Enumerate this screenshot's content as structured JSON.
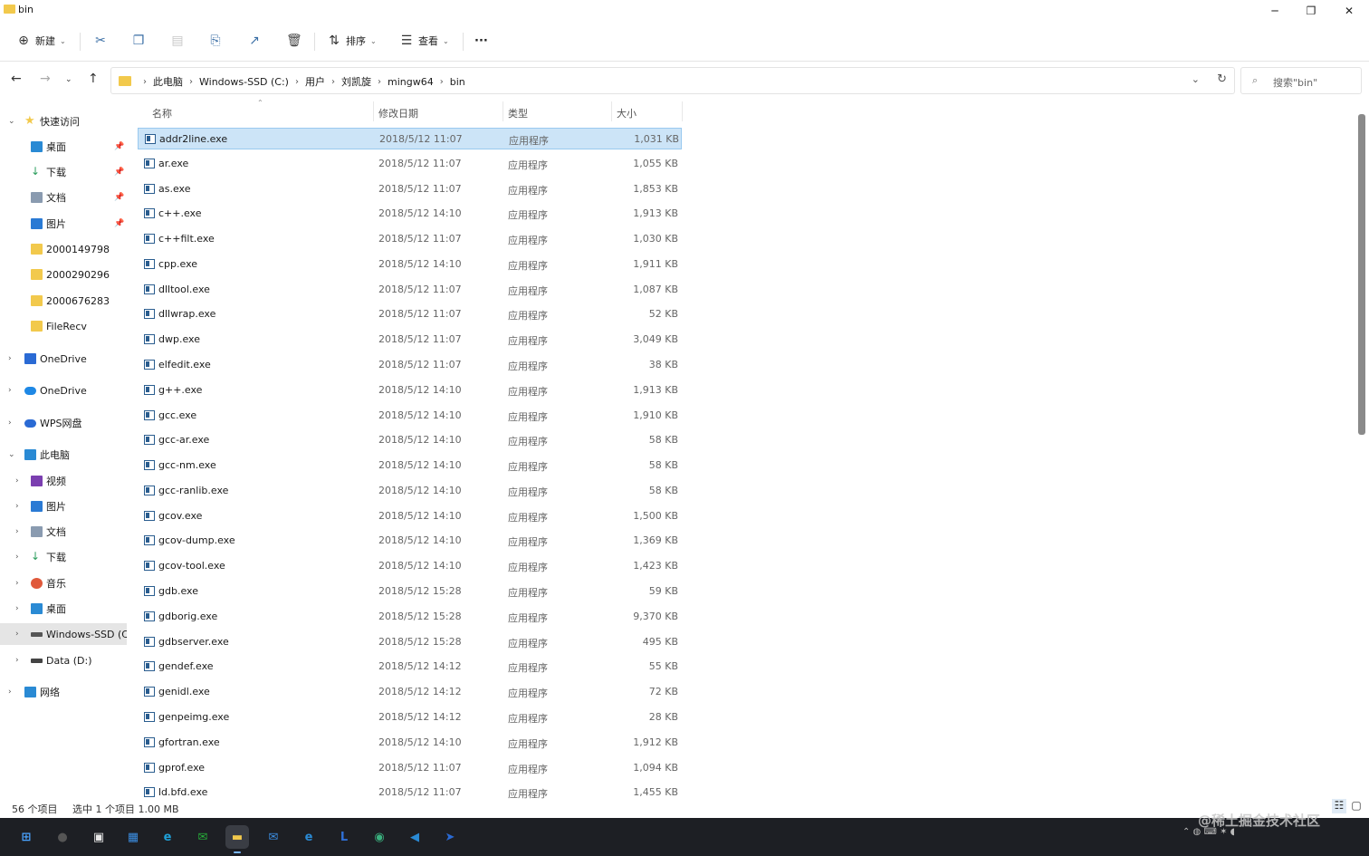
{
  "window": {
    "title": "bin",
    "minimize": "─",
    "maximize": "❐",
    "close": "✕"
  },
  "toolbar": {
    "new_label": "新建",
    "sort_label": "排序",
    "view_label": "查看",
    "more_label": "···"
  },
  "address": {
    "crumbs": [
      "此电脑",
      "Windows-SSD (C:)",
      "用户",
      "刘凯旋",
      "mingw64",
      "bin"
    ],
    "search_placeholder": "搜索\"bin\""
  },
  "nav": {
    "items": [
      {
        "label": "快速访问",
        "icon": "star-icon",
        "color": "#f2c94c"
      },
      {
        "label": "桌面",
        "icon": "desktop-icon",
        "color": "#2a8ad4"
      },
      {
        "label": "下载",
        "icon": "download-icon",
        "color": "#2a9d5c"
      },
      {
        "label": "文档",
        "icon": "document-icon",
        "color": "#8a9bb0"
      },
      {
        "label": "图片",
        "icon": "pictures-icon",
        "color": "#2a7ad4"
      },
      {
        "label": "2000149798",
        "icon": "folder-icon",
        "color": "#f2c94c"
      },
      {
        "label": "2000290296",
        "icon": "folder-icon",
        "color": "#f2c94c"
      },
      {
        "label": "2000676283",
        "icon": "folder-icon",
        "color": "#f2c94c"
      },
      {
        "label": "FileRecv",
        "icon": "folder-icon",
        "color": "#f2c94c"
      },
      {
        "label": "OneDrive",
        "icon": "onedrive-icon",
        "color": "#2a6ad4"
      },
      {
        "label": "OneDrive",
        "icon": "cloud-icon",
        "color": "#1e88e5"
      },
      {
        "label": "WPS网盘",
        "icon": "wps-cloud-icon",
        "color": "#2a6ad4"
      },
      {
        "label": "此电脑",
        "icon": "pc-icon",
        "color": "#2a8ad4"
      },
      {
        "label": "视频",
        "icon": "video-icon",
        "color": "#7b3fb0"
      },
      {
        "label": "图片",
        "icon": "pictures-icon",
        "color": "#2a7ad4"
      },
      {
        "label": "文档",
        "icon": "document-icon",
        "color": "#8a9bb0"
      },
      {
        "label": "下载",
        "icon": "download-icon",
        "color": "#2a9d5c"
      },
      {
        "label": "音乐",
        "icon": "music-icon",
        "color": "#e0593b"
      },
      {
        "label": "桌面",
        "icon": "desktop-icon",
        "color": "#2a8ad4"
      },
      {
        "label": "Windows-SSD (C:)",
        "icon": "drive-icon",
        "color": "#555555"
      },
      {
        "label": "Data (D:)",
        "icon": "drive-icon",
        "color": "#444444"
      },
      {
        "label": "网络",
        "icon": "network-icon",
        "color": "#2a8ad4"
      }
    ]
  },
  "list": {
    "columns": [
      "名称",
      "修改日期",
      "类型",
      "大小"
    ],
    "rows": [
      [
        "addr2line.exe",
        "2018/5/12 11:07",
        "应用程序",
        "1,031 KB"
      ],
      [
        "ar.exe",
        "2018/5/12 11:07",
        "应用程序",
        "1,055 KB"
      ],
      [
        "as.exe",
        "2018/5/12 11:07",
        "应用程序",
        "1,853 KB"
      ],
      [
        "c++.exe",
        "2018/5/12 14:10",
        "应用程序",
        "1,913 KB"
      ],
      [
        "c++filt.exe",
        "2018/5/12 11:07",
        "应用程序",
        "1,030 KB"
      ],
      [
        "cpp.exe",
        "2018/5/12 14:10",
        "应用程序",
        "1,911 KB"
      ],
      [
        "dlltool.exe",
        "2018/5/12 11:07",
        "应用程序",
        "1,087 KB"
      ],
      [
        "dllwrap.exe",
        "2018/5/12 11:07",
        "应用程序",
        "52 KB"
      ],
      [
        "dwp.exe",
        "2018/5/12 11:07",
        "应用程序",
        "3,049 KB"
      ],
      [
        "elfedit.exe",
        "2018/5/12 11:07",
        "应用程序",
        "38 KB"
      ],
      [
        "g++.exe",
        "2018/5/12 14:10",
        "应用程序",
        "1,913 KB"
      ],
      [
        "gcc.exe",
        "2018/5/12 14:10",
        "应用程序",
        "1,910 KB"
      ],
      [
        "gcc-ar.exe",
        "2018/5/12 14:10",
        "应用程序",
        "58 KB"
      ],
      [
        "gcc-nm.exe",
        "2018/5/12 14:10",
        "应用程序",
        "58 KB"
      ],
      [
        "gcc-ranlib.exe",
        "2018/5/12 14:10",
        "应用程序",
        "58 KB"
      ],
      [
        "gcov.exe",
        "2018/5/12 14:10",
        "应用程序",
        "1,500 KB"
      ],
      [
        "gcov-dump.exe",
        "2018/5/12 14:10",
        "应用程序",
        "1,369 KB"
      ],
      [
        "gcov-tool.exe",
        "2018/5/12 14:10",
        "应用程序",
        "1,423 KB"
      ],
      [
        "gdb.exe",
        "2018/5/12 15:28",
        "应用程序",
        "59 KB"
      ],
      [
        "gdborig.exe",
        "2018/5/12 15:28",
        "应用程序",
        "9,370 KB"
      ],
      [
        "gdbserver.exe",
        "2018/5/12 15:28",
        "应用程序",
        "495 KB"
      ],
      [
        "gendef.exe",
        "2018/5/12 14:12",
        "应用程序",
        "55 KB"
      ],
      [
        "genidl.exe",
        "2018/5/12 14:12",
        "应用程序",
        "72 KB"
      ],
      [
        "genpeimg.exe",
        "2018/5/12 14:12",
        "应用程序",
        "28 KB"
      ],
      [
        "gfortran.exe",
        "2018/5/12 14:10",
        "应用程序",
        "1,912 KB"
      ],
      [
        "gprof.exe",
        "2018/5/12 11:07",
        "应用程序",
        "1,094 KB"
      ],
      [
        "ld.bfd.exe",
        "2018/5/12 11:07",
        "应用程序",
        "1,455 KB"
      ]
    ]
  },
  "status": {
    "count": "56 个项目",
    "selection": "选中 1 个项目  1.00 MB"
  },
  "taskbar": {
    "items": [
      {
        "name": "start-icon",
        "glyph": "⊞",
        "color": "#4aa3ff"
      },
      {
        "name": "search-icon",
        "glyph": "●",
        "color": "#555555"
      },
      {
        "name": "task-view-icon",
        "glyph": "▣",
        "color": "#e8e8e8"
      },
      {
        "name": "widgets-icon",
        "glyph": "▦",
        "color": "#3b8de0"
      },
      {
        "name": "edge-icon",
        "glyph": "e",
        "color": "#1fa0d8"
      },
      {
        "name": "wechat-icon",
        "glyph": "✉",
        "color": "#27ae3a"
      },
      {
        "name": "file-explorer-icon",
        "glyph": "▬",
        "color": "#f2c94c"
      },
      {
        "name": "mail-icon",
        "glyph": "✉",
        "color": "#3b8de0"
      },
      {
        "name": "browser-icon",
        "glyph": "e",
        "color": "#2a8ad4"
      },
      {
        "name": "lark-icon",
        "glyph": "L",
        "color": "#2f6fd6"
      },
      {
        "name": "color-app-icon",
        "glyph": "◉",
        "color": "#3ab07e"
      },
      {
        "name": "vscode-icon",
        "glyph": "◀",
        "color": "#2a8ad4"
      },
      {
        "name": "feishu-icon",
        "glyph": "➤",
        "color": "#2a6ad4"
      }
    ]
  },
  "watermark": "@稀土掘金技术社区"
}
